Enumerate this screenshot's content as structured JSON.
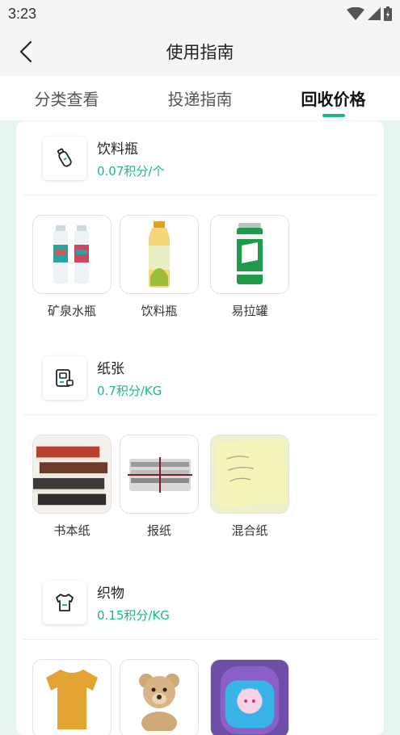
{
  "status_bar": {
    "time": "3:23"
  },
  "app_bar": {
    "title": "使用指南"
  },
  "tabs": [
    {
      "label": "分类查看",
      "active": false
    },
    {
      "label": "投递指南",
      "active": false
    },
    {
      "label": "回收价格",
      "active": true
    }
  ],
  "colors": {
    "accent": "#1db882",
    "background": "#e7f5ef"
  },
  "categories": [
    {
      "name": "饮料瓶",
      "price": "0.07积分/个",
      "icon": "bottle-icon",
      "items": [
        {
          "label": "矿泉水瓶"
        },
        {
          "label": "饮料瓶"
        },
        {
          "label": "易拉罐"
        }
      ]
    },
    {
      "name": "纸张",
      "price": "0.7积分/KG",
      "icon": "paper-icon",
      "items": [
        {
          "label": "书本纸"
        },
        {
          "label": "报纸"
        },
        {
          "label": "混合纸"
        }
      ]
    },
    {
      "name": "织物",
      "price": "0.15积分/KG",
      "icon": "clothes-icon",
      "items": [
        {
          "label": ""
        },
        {
          "label": ""
        },
        {
          "label": ""
        }
      ]
    }
  ]
}
